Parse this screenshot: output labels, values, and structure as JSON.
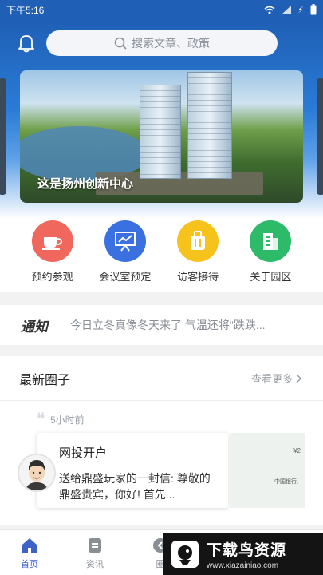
{
  "status_bar": {
    "time": "下午5:16",
    "icons": [
      "wifi-icon",
      "signal-icon",
      "charging-icon",
      "battery-icon"
    ]
  },
  "search": {
    "placeholder": "搜索文章、政策"
  },
  "banner": {
    "caption": "这是扬州创新中心"
  },
  "quick_actions": [
    {
      "label": "预约参观",
      "icon": "coffee-cup-icon",
      "color": "#f0675d"
    },
    {
      "label": "会议室预定",
      "icon": "presentation-board-icon",
      "color": "#3a70e0"
    },
    {
      "label": "访客接待",
      "icon": "luggage-icon",
      "color": "#f5c31b"
    },
    {
      "label": "关于园区",
      "icon": "building-icon",
      "color": "#2dbb6a"
    }
  ],
  "notice": {
    "tag": "通知",
    "text": "今日立冬真像冬天来了 气温还将\"跌跌..."
  },
  "circle": {
    "title": "最新圈子",
    "more_label": "查看更多",
    "post": {
      "time": "5小时前",
      "title": "网投开户",
      "body": "送给鼎盛玩家的一封信: 尊敬的鼎盛贵宾，你好! 首先...",
      "thumb_text_1": "¥2",
      "thumb_text_2": "中国银行,"
    }
  },
  "tabbar": {
    "items": [
      {
        "label": "首页",
        "icon": "home-icon",
        "active": true
      },
      {
        "label": "资讯",
        "icon": "news-icon",
        "active": false
      },
      {
        "label": "圈",
        "icon": "circle-icon",
        "active": false
      }
    ],
    "active_color": "#3d63c9"
  },
  "watermark": {
    "title": "下载鸟资源",
    "url": "www.xiazainiao.com"
  }
}
